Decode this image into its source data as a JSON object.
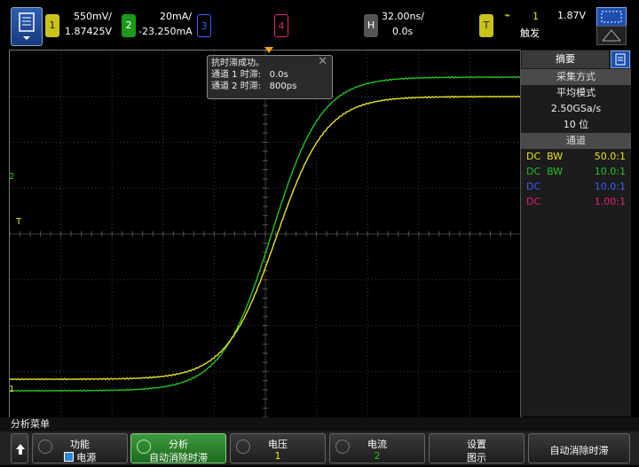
{
  "channels": {
    "ch1": {
      "number": "1",
      "scale": "550mV/",
      "offset": "1.87425V",
      "color": "#e8e21c"
    },
    "ch2": {
      "number": "2",
      "scale": "20mA/",
      "offset": "-23.250mA",
      "color": "#22c022"
    },
    "ch3": {
      "number": "3",
      "color": "#3a5fff"
    },
    "ch4": {
      "number": "4",
      "color": "#e0207a"
    }
  },
  "timebase": {
    "key": "H",
    "scale": "32.00ns/",
    "delay": "0.0s"
  },
  "trigger": {
    "key": "T",
    "source": "1",
    "level": "1.87V",
    "mode": "触发",
    "slope_icon": "rising-edge-icon"
  },
  "waveform_markers": {
    "ch1": "1",
    "ch2": "2",
    "trigger": "T"
  },
  "popup": {
    "line1": "抗时滞成功。",
    "line2_label": "通道 1 时滞:",
    "line2_value": "0.0s",
    "line3_label": "通道 2 时滞:",
    "line3_value": "800ps",
    "close_icon": "close-icon"
  },
  "side_panel": {
    "tab_label": "摘要",
    "acq_header": "采集方式",
    "acq_mode": "平均模式",
    "sample_rate": "2.50GSa/s",
    "bits": "10 位",
    "ch_header": "通道",
    "rows": [
      {
        "coupling": "DC",
        "bw": "BW",
        "probe": "50.0:1",
        "color": "#e8e21c"
      },
      {
        "coupling": "DC",
        "bw": "BW",
        "probe": "10.0:1",
        "color": "#22c022"
      },
      {
        "coupling": "DC",
        "bw": "",
        "probe": "10.0:1",
        "color": "#3a5fff"
      },
      {
        "coupling": "DC",
        "bw": "",
        "probe": "1.00:1",
        "color": "#e0207a"
      }
    ]
  },
  "menu": {
    "title": "分析菜单",
    "softkeys": [
      {
        "label": "功能",
        "value": "电源"
      },
      {
        "label": "分析",
        "value": "自动消除时滞"
      },
      {
        "label": "电压",
        "value": "1"
      },
      {
        "label": "电流",
        "value": "2"
      },
      {
        "label": "设置",
        "value": "图示"
      },
      {
        "label": "自动消除时滞",
        "value": ""
      }
    ]
  }
}
